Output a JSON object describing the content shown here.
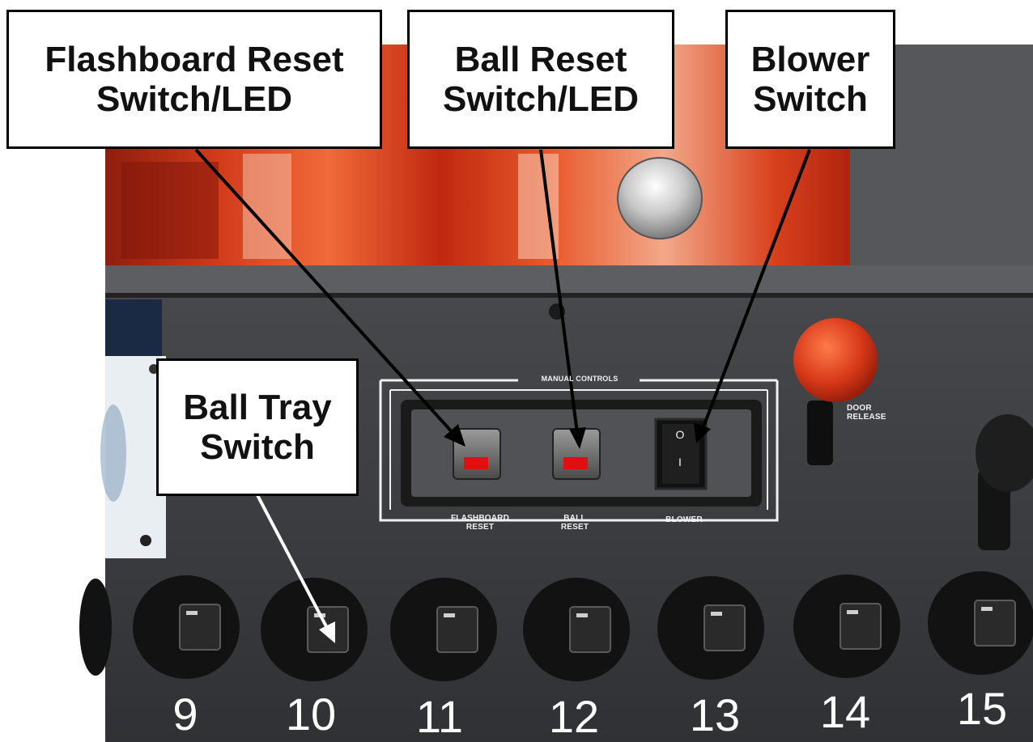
{
  "callouts": {
    "flashboard_line1": "Flashboard Reset",
    "flashboard_line2": "Switch/LED",
    "ball_reset_line1": "Ball Reset",
    "ball_reset_line2": "Switch/LED",
    "blower_line1": "Blower",
    "blower_line2": "Switch",
    "ball_tray_line1": "Ball Tray",
    "ball_tray_line2": "Switch"
  },
  "panel": {
    "manual_controls": "MANUAL CONTROLS",
    "flashboard_line1": "FLASHBOARD",
    "flashboard_line2": "RESET",
    "ball_line1": "BALL",
    "ball_line2": "RESET",
    "blower": "BLOWER",
    "door_line1": "DOOR",
    "door_line2": "RELEASE",
    "rocker_on": "I",
    "rocker_off": "O"
  },
  "bins": [
    "9",
    "10",
    "11",
    "12",
    "13",
    "14",
    "15"
  ],
  "colors": {
    "plexi_red": "#c82a12",
    "cabinet": "#3a3c40",
    "led_red": "#e01010",
    "knob_red": "#d63818"
  }
}
